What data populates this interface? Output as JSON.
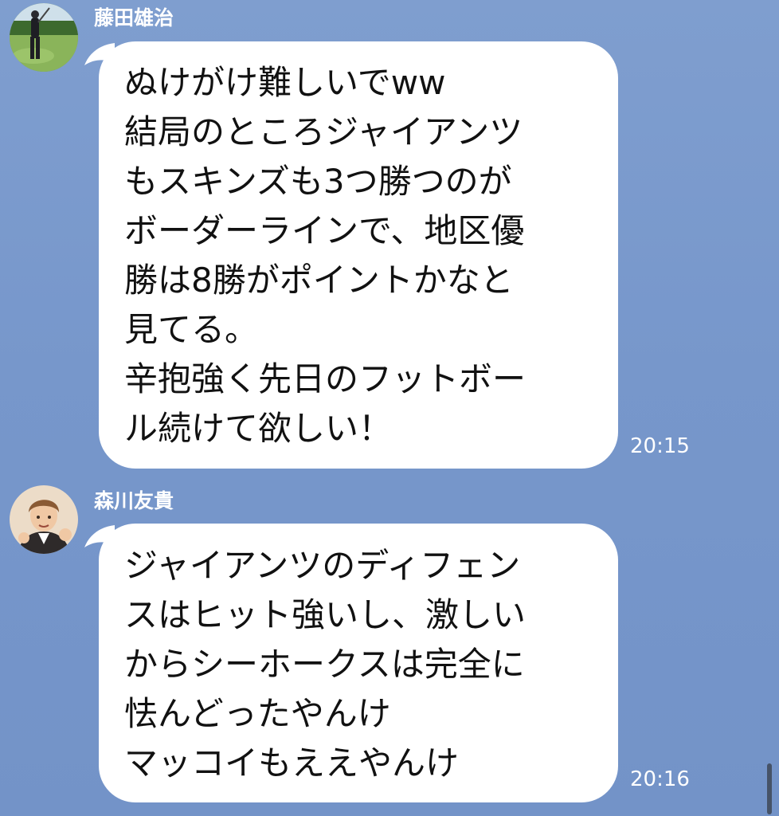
{
  "messages": [
    {
      "sender": "藤田雄治",
      "avatar_icon": "golfer-photo-avatar",
      "text": "ぬけがけ難しいでww\n結局のところジャイアンツ\nもスキンズも3つ勝つのが\nボーダーラインで、地区優\n勝は8勝がポイントかなと\n見てる。\n辛抱強く先日のフットボー\nル続けて欲しい！",
      "time": "20:15"
    },
    {
      "sender": "森川友貴",
      "avatar_icon": "cartoon-man-avatar",
      "text": "ジャイアンツのディフェン\nスはヒット強いし、激しい\nからシーホークスは完全に\n怯んどったやんけ\nマッコイもええやんけ",
      "time": "20:16"
    }
  ],
  "colors": {
    "background": "#7797cb",
    "bubble": "#ffffff",
    "text": "#111111",
    "meta_text": "#ffffff"
  }
}
